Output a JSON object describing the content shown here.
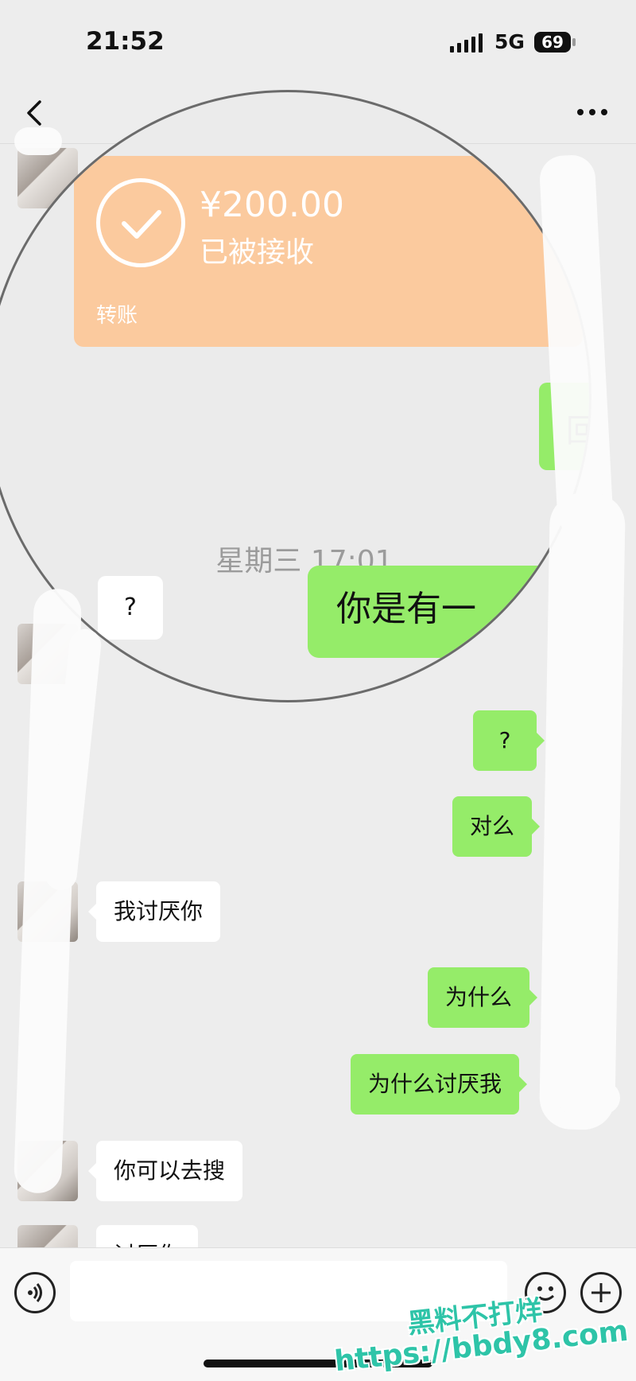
{
  "status_bar": {
    "time": "21:52",
    "network": "5G",
    "battery": "69"
  },
  "nav": {
    "back_icon": "chevron-left-icon",
    "more_icon": "more-dots-icon"
  },
  "transfer": {
    "amount": "¥200.00",
    "status": "已被接收",
    "label": "转账"
  },
  "magnified": {
    "partial_green": "回",
    "timestamp": "星期三 17:01",
    "sent_partial": "你是有一",
    "received_partial": "?"
  },
  "messages": [
    {
      "side": "out",
      "text": "?"
    },
    {
      "side": "out",
      "text": "对么"
    },
    {
      "side": "in",
      "text": "我讨厌你"
    },
    {
      "side": "out",
      "text": "为什么"
    },
    {
      "side": "out",
      "text": "为什么讨厌我"
    },
    {
      "side": "in",
      "text": "你可以去搜"
    },
    {
      "side": "in",
      "text": "讨厌你"
    }
  ],
  "input": {
    "placeholder": ""
  },
  "watermark": {
    "line1": "黑料不打烊",
    "line2": "https://bbdy8.com"
  },
  "colors": {
    "sent_bubble": "#95ec69",
    "received_bubble": "#ffffff",
    "transfer_card": "#fbca9e",
    "background": "#ededed"
  }
}
